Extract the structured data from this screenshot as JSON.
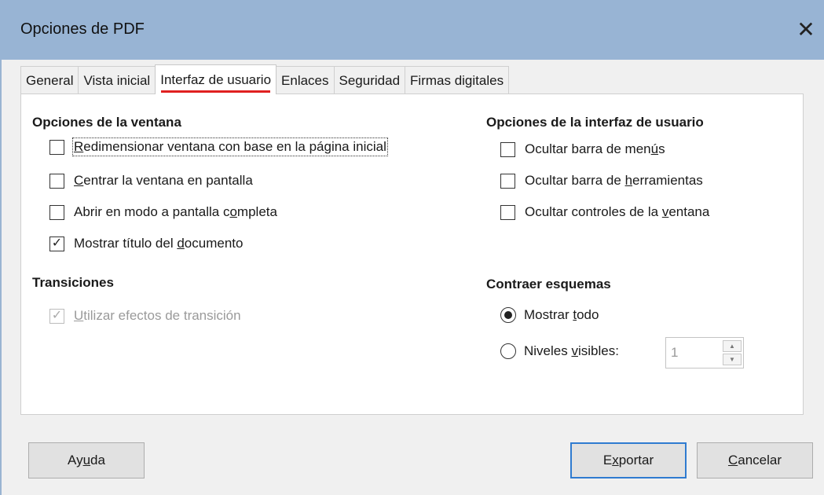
{
  "window": {
    "title": "Opciones de PDF",
    "close_glyph": "✕"
  },
  "tabs": [
    {
      "label": "General"
    },
    {
      "label": "Vista inicial"
    },
    {
      "label": "Interfaz de usuario",
      "active": true
    },
    {
      "label": "Enlaces"
    },
    {
      "label": "Seguridad"
    },
    {
      "label": "Firmas digitales"
    }
  ],
  "window_options": {
    "heading": "Opciones de la ventana",
    "items": [
      {
        "pre": "",
        "key": "R",
        "post": "edimensionar ventana con base en la página inicial",
        "checked": false
      },
      {
        "pre": "",
        "key": "C",
        "post": "entrar la ventana en pantalla",
        "checked": false
      },
      {
        "pre": "Abrir en modo a pantalla c",
        "key": "o",
        "post": "mpleta",
        "checked": false
      },
      {
        "pre": "Mostrar título del ",
        "key": "d",
        "post": "ocumento",
        "checked": true
      }
    ]
  },
  "transitions": {
    "heading": "Transiciones",
    "item": {
      "pre": "",
      "key": "U",
      "post": "tilizar efectos de transición",
      "checked": true,
      "disabled": true
    }
  },
  "ui_options": {
    "heading": "Opciones de la interfaz de usuario",
    "items": [
      {
        "pre": "Ocultar barra de men",
        "key": "ú",
        "post": "s",
        "checked": false
      },
      {
        "pre": "Ocultar barra de ",
        "key": "h",
        "post": "erramientas",
        "checked": false
      },
      {
        "pre": "Ocultar controles de la ",
        "key": "v",
        "post": "entana",
        "checked": false
      }
    ]
  },
  "collapse": {
    "heading": "Contraer esquemas",
    "show_all": {
      "pre": "Mostrar ",
      "key": "t",
      "post": "odo",
      "selected": true
    },
    "visible_levels": {
      "pre": "Niveles ",
      "key": "v",
      "post": "isibles:",
      "selected": false,
      "value": "1"
    }
  },
  "buttons": {
    "help": {
      "pre": "Ay",
      "key": "u",
      "post": "da"
    },
    "export": {
      "pre": "E",
      "key": "x",
      "post": "portar"
    },
    "cancel": {
      "pre": "",
      "key": "C",
      "post": "ancelar"
    }
  }
}
